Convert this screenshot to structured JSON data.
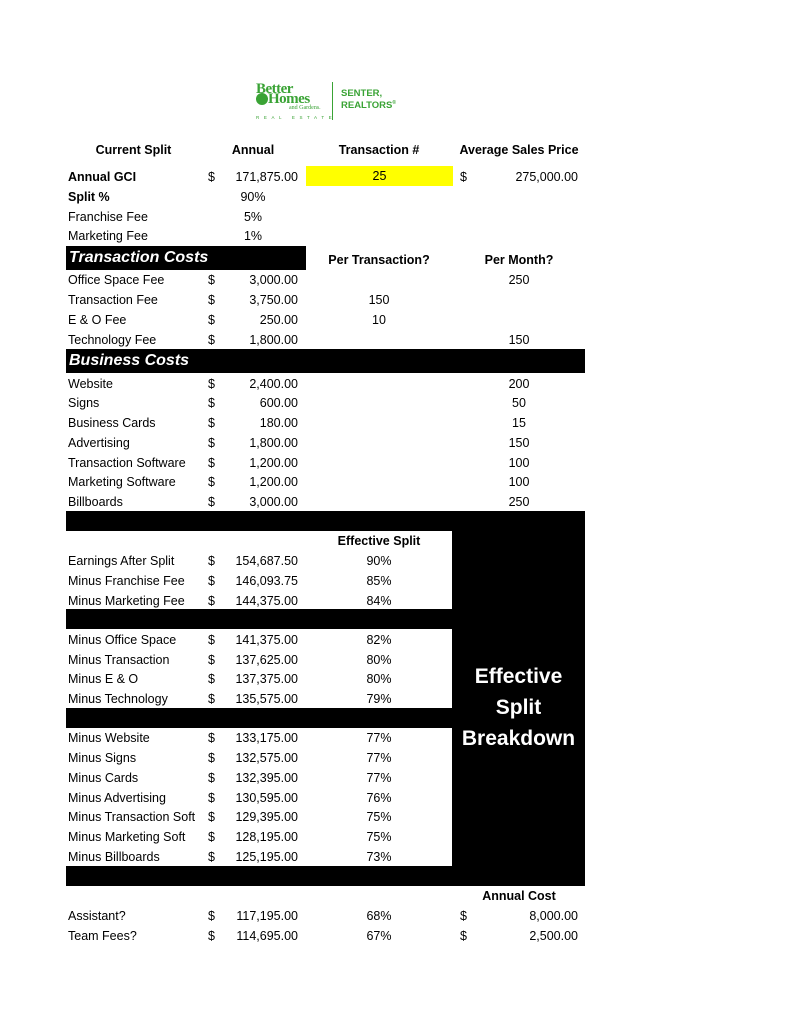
{
  "logo": {
    "line1": "Better",
    "line2": "Homes",
    "line3": "and Gardens.",
    "line4": "REAL ESTATE",
    "partner1": "SENTER,",
    "partner2": "REALTORS",
    "partner_mark": "®",
    "brand_color": "#3aa335"
  },
  "header": {
    "col1": "Current Split",
    "col2": "Annual",
    "col3": "Transaction #",
    "col4": "Average Sales Price"
  },
  "summary": {
    "gci_label": "Annual GCI",
    "gci_currency": "$",
    "gci_value": "171,875.00",
    "transactions": "25",
    "transactions_highlight": "#ffff00",
    "avg_price_currency": "$",
    "avg_price_value": "275,000.00",
    "split_label": "Split %",
    "split_value": "90%",
    "franchise_label": "Franchise Fee",
    "franchise_value": "5%",
    "marketing_label": "Marketing Fee",
    "marketing_value": "1%"
  },
  "transaction_costs": {
    "title": "Transaction Costs",
    "per_transaction_header": "Per Transaction?",
    "per_month_header": "Per Month?",
    "rows": [
      {
        "label": "Office Space Fee",
        "cur": "$",
        "annual": "3,000.00",
        "per_tx": "",
        "per_month": "250"
      },
      {
        "label": "Transaction Fee",
        "cur": "$",
        "annual": "3,750.00",
        "per_tx": "150",
        "per_month": ""
      },
      {
        "label": "E & O Fee",
        "cur": "$",
        "annual": "250.00",
        "per_tx": "10",
        "per_month": ""
      },
      {
        "label": "Technology Fee",
        "cur": "$",
        "annual": "1,800.00",
        "per_tx": "",
        "per_month": "150"
      }
    ]
  },
  "business_costs": {
    "title": "Business Costs",
    "rows": [
      {
        "label": "Website",
        "cur": "$",
        "annual": "2,400.00",
        "per_month": "200"
      },
      {
        "label": "Signs",
        "cur": "$",
        "annual": "600.00",
        "per_month": "50"
      },
      {
        "label": "Business Cards",
        "cur": "$",
        "annual": "180.00",
        "per_month": "15"
      },
      {
        "label": "Advertising",
        "cur": "$",
        "annual": "1,800.00",
        "per_month": "150"
      },
      {
        "label": "Transaction Software",
        "cur": "$",
        "annual": "1,200.00",
        "per_month": "100"
      },
      {
        "label": "Marketing Software",
        "cur": "$",
        "annual": "1,200.00",
        "per_month": "100"
      },
      {
        "label": "Billboards",
        "cur": "$",
        "annual": "3,000.00",
        "per_month": "250"
      }
    ]
  },
  "breakdown": {
    "effective_split_header": "Effective Split",
    "side_label_1": "Effective",
    "side_label_2": "Split",
    "side_label_3": "Breakdown",
    "group1": [
      {
        "label": "Earnings After Split",
        "cur": "$",
        "amount": "154,687.50",
        "pct": "90%"
      },
      {
        "label": "Minus Franchise Fee",
        "cur": "$",
        "amount": "146,093.75",
        "pct": "85%"
      },
      {
        "label": "Minus Marketing Fee",
        "cur": "$",
        "amount": "144,375.00",
        "pct": "84%"
      }
    ],
    "group2": [
      {
        "label": "Minus Office Space",
        "cur": "$",
        "amount": "141,375.00",
        "pct": "82%"
      },
      {
        "label": "Minus Transaction",
        "cur": "$",
        "amount": "137,625.00",
        "pct": "80%"
      },
      {
        "label": "Minus E & O",
        "cur": "$",
        "amount": "137,375.00",
        "pct": "80%"
      },
      {
        "label": "Minus Technology",
        "cur": "$",
        "amount": "135,575.00",
        "pct": "79%"
      }
    ],
    "group3": [
      {
        "label": "Minus Website",
        "cur": "$",
        "amount": "133,175.00",
        "pct": "77%"
      },
      {
        "label": "Minus Signs",
        "cur": "$",
        "amount": "132,575.00",
        "pct": "77%"
      },
      {
        "label": "Minus Cards",
        "cur": "$",
        "amount": "132,395.00",
        "pct": "77%"
      },
      {
        "label": "Minus Advertising",
        "cur": "$",
        "amount": "130,595.00",
        "pct": "76%"
      },
      {
        "label": "Minus Transaction Soft",
        "cur": "$",
        "amount": "129,395.00",
        "pct": "75%"
      },
      {
        "label": "Minus Marketing Soft",
        "cur": "$",
        "amount": "128,195.00",
        "pct": "75%"
      },
      {
        "label": "Minus Billboards",
        "cur": "$",
        "amount": "125,195.00",
        "pct": "73%"
      }
    ]
  },
  "extras": {
    "annual_cost_header": "Annual Cost",
    "rows": [
      {
        "label": "Assistant?",
        "cur": "$",
        "amount": "117,195.00",
        "pct": "68%",
        "cost_cur": "$",
        "cost": "8,000.00"
      },
      {
        "label": "Team Fees?",
        "cur": "$",
        "amount": "114,695.00",
        "pct": "67%",
        "cost_cur": "$",
        "cost": "2,500.00"
      }
    ]
  }
}
